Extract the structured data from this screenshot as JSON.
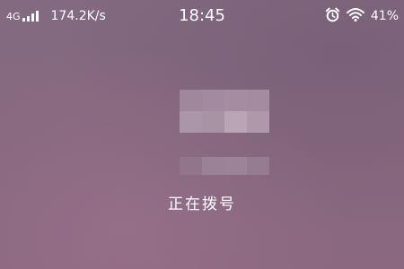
{
  "status_bar": {
    "network_type": "4G",
    "network_speed": "174.2K/s",
    "time": "18:45",
    "battery_percent": "41%",
    "icons": [
      "signal-strength-icon",
      "alarm-clock-icon",
      "wifi-icon"
    ]
  },
  "call": {
    "status": "正在拨号"
  },
  "colors": {
    "background": "#86697f",
    "text": "#ffffff"
  }
}
